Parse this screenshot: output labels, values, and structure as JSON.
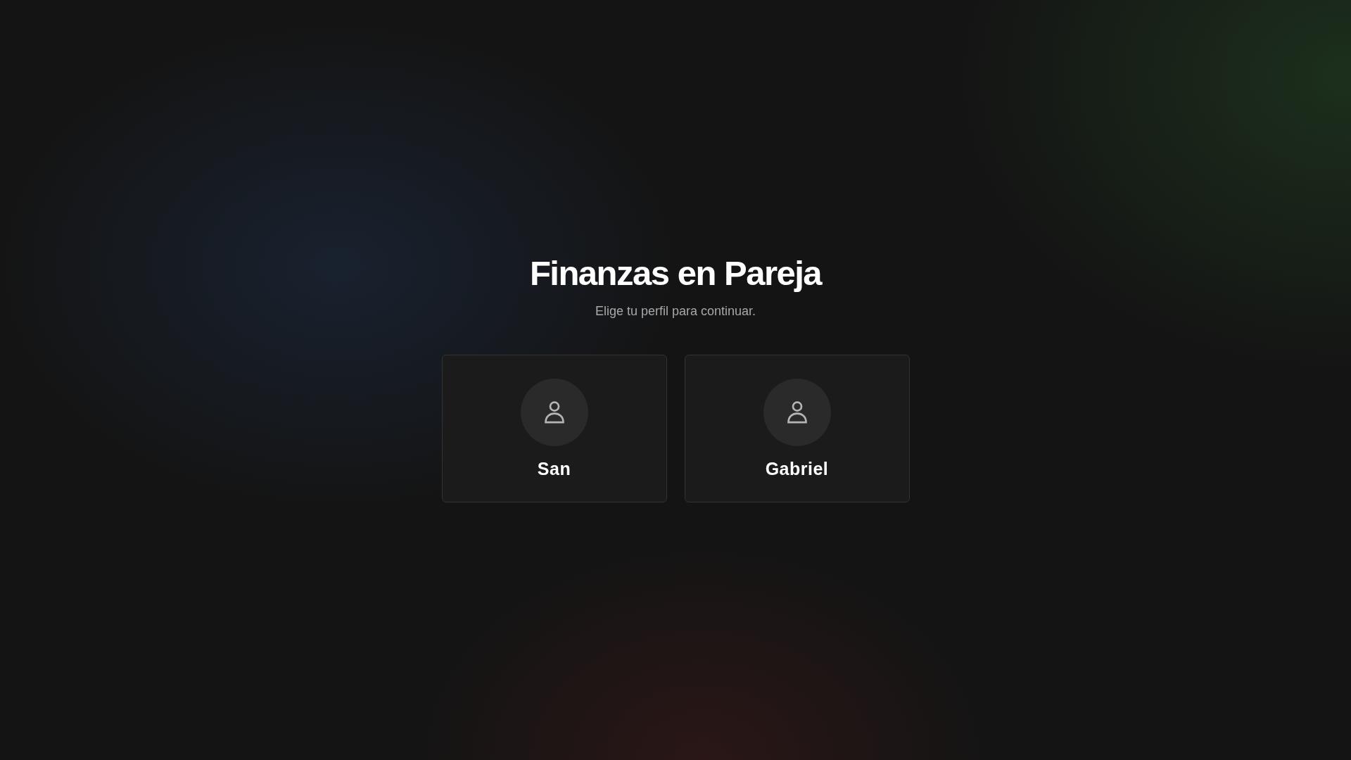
{
  "title": "Finanzas en Pareja",
  "subtitle": "Elige tu perfil para continuar.",
  "profiles": [
    {
      "name": "San"
    },
    {
      "name": "Gabriel"
    }
  ]
}
